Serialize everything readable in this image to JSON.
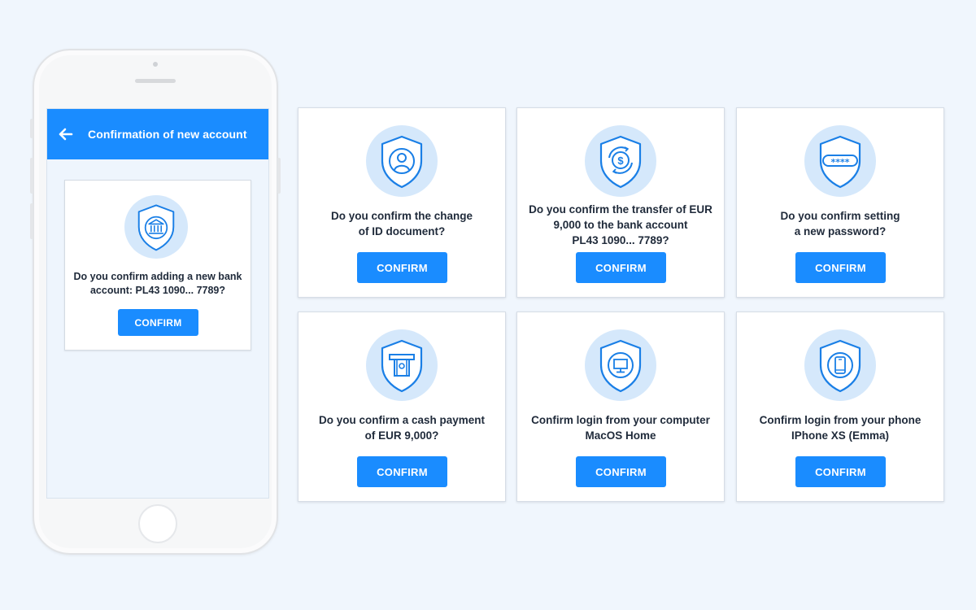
{
  "phone": {
    "header_title": "Confirmation of new account",
    "card": {
      "icon": "bank-icon",
      "question_lines": [
        "Do you confirm adding a new bank",
        "account: PL43 1090... 7789?"
      ],
      "button_label": "CONFIRM"
    }
  },
  "cards": [
    {
      "icon": "user-id-icon",
      "question_lines": [
        "Do you confirm the change",
        "of ID document?"
      ],
      "button_label": "CONFIRM"
    },
    {
      "icon": "dollar-transfer-icon",
      "question_lines": [
        "Do you confirm the transfer of EUR",
        "9,000 to the bank account",
        "PL43 1090... 7789?"
      ],
      "button_label": "CONFIRM"
    },
    {
      "icon": "password-icon",
      "question_lines": [
        "Do you confirm setting",
        "a new password?"
      ],
      "button_label": "CONFIRM"
    },
    {
      "icon": "atm-cash-icon",
      "question_lines": [
        "Do you confirm a cash payment",
        "of EUR 9,000?"
      ],
      "button_label": "CONFIRM"
    },
    {
      "icon": "computer-icon",
      "question_lines": [
        "Confirm login from your computer",
        "MacOS Home"
      ],
      "button_label": "CONFIRM"
    },
    {
      "icon": "phone-icon",
      "question_lines": [
        "Confirm login from your phone",
        "IPhone XS (Emma)"
      ],
      "button_label": "CONFIRM"
    }
  ],
  "colors": {
    "accent": "#1a8cff",
    "icon_circle": "#d5e8fb",
    "icon_stroke": "#1a7fe6",
    "background": "#f0f6fd"
  }
}
